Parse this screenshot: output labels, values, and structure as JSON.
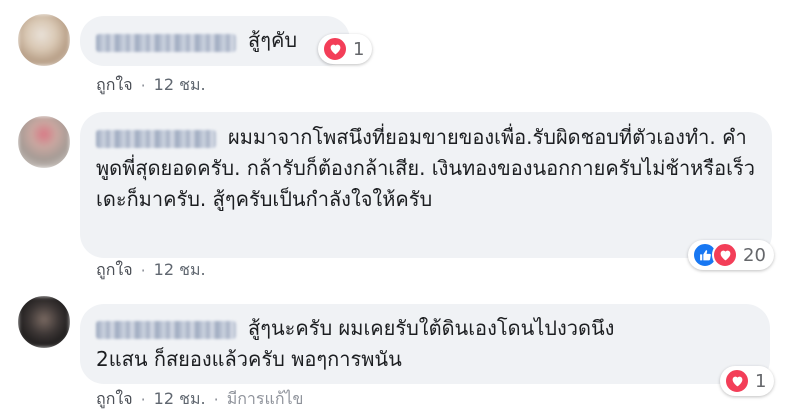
{
  "comments": [
    {
      "text": "สู้ๆคับ",
      "reactions_count": "1",
      "like_label": "ถูกใจ",
      "separator": "·",
      "time": "12 ชม.",
      "edited_label": ""
    },
    {
      "text": "ผมมาจากโพสนึงที่ยอมขายของเพื่อ.รับผิดชอบที่ตัวเองทำ. คำพูดพี่สุดยอดครับ. กล้ารับก็ต้องกล้าเสีย. เงินทองของนอกกายครับไม่ช้าหรือเร็วเดะก็มาครับ. สู้ๆครับเป็นกำลังใจให้ครับ",
      "reactions_count": "20",
      "like_label": "ถูกใจ",
      "separator": "·",
      "time": "12 ชม.",
      "edited_label": ""
    },
    {
      "text": "สู้ๆนะครับ ผมเคยรับใต้ดินเองโดนไปงวดนึง 2แสน ก็สยองแล้วครับ พอๆการพนัน",
      "reactions_count": "1",
      "like_label": "ถูกใจ",
      "separator": "·",
      "time": "12 ชม.",
      "edited_label": "มีการแก้ไข"
    }
  ],
  "colors": {
    "bubble": "#f0f2f5",
    "like_blue": "#1877f2",
    "love_red": "#f33e58",
    "meta_gray": "#606770"
  },
  "icons": {
    "like": "thumbs-up-icon",
    "love": "heart-icon"
  }
}
